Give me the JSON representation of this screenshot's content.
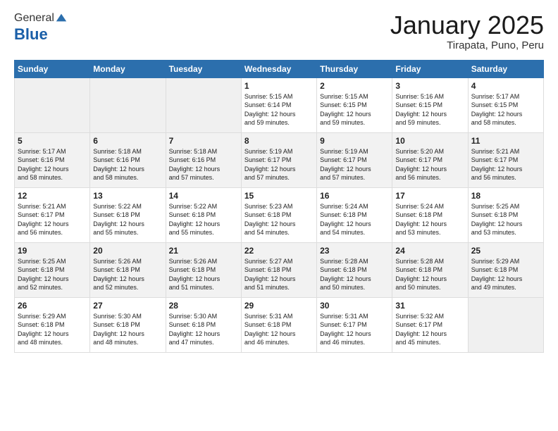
{
  "header": {
    "logo_general": "General",
    "logo_blue": "Blue",
    "calendar_title": "January 2025",
    "calendar_subtitle": "Tirapata, Puno, Peru"
  },
  "days_of_week": [
    "Sunday",
    "Monday",
    "Tuesday",
    "Wednesday",
    "Thursday",
    "Friday",
    "Saturday"
  ],
  "weeks": [
    [
      {
        "num": "",
        "info": ""
      },
      {
        "num": "",
        "info": ""
      },
      {
        "num": "",
        "info": ""
      },
      {
        "num": "1",
        "info": "Sunrise: 5:15 AM\nSunset: 6:14 PM\nDaylight: 12 hours\nand 59 minutes."
      },
      {
        "num": "2",
        "info": "Sunrise: 5:15 AM\nSunset: 6:15 PM\nDaylight: 12 hours\nand 59 minutes."
      },
      {
        "num": "3",
        "info": "Sunrise: 5:16 AM\nSunset: 6:15 PM\nDaylight: 12 hours\nand 59 minutes."
      },
      {
        "num": "4",
        "info": "Sunrise: 5:17 AM\nSunset: 6:15 PM\nDaylight: 12 hours\nand 58 minutes."
      }
    ],
    [
      {
        "num": "5",
        "info": "Sunrise: 5:17 AM\nSunset: 6:16 PM\nDaylight: 12 hours\nand 58 minutes."
      },
      {
        "num": "6",
        "info": "Sunrise: 5:18 AM\nSunset: 6:16 PM\nDaylight: 12 hours\nand 58 minutes."
      },
      {
        "num": "7",
        "info": "Sunrise: 5:18 AM\nSunset: 6:16 PM\nDaylight: 12 hours\nand 57 minutes."
      },
      {
        "num": "8",
        "info": "Sunrise: 5:19 AM\nSunset: 6:17 PM\nDaylight: 12 hours\nand 57 minutes."
      },
      {
        "num": "9",
        "info": "Sunrise: 5:19 AM\nSunset: 6:17 PM\nDaylight: 12 hours\nand 57 minutes."
      },
      {
        "num": "10",
        "info": "Sunrise: 5:20 AM\nSunset: 6:17 PM\nDaylight: 12 hours\nand 56 minutes."
      },
      {
        "num": "11",
        "info": "Sunrise: 5:21 AM\nSunset: 6:17 PM\nDaylight: 12 hours\nand 56 minutes."
      }
    ],
    [
      {
        "num": "12",
        "info": "Sunrise: 5:21 AM\nSunset: 6:17 PM\nDaylight: 12 hours\nand 56 minutes."
      },
      {
        "num": "13",
        "info": "Sunrise: 5:22 AM\nSunset: 6:18 PM\nDaylight: 12 hours\nand 55 minutes."
      },
      {
        "num": "14",
        "info": "Sunrise: 5:22 AM\nSunset: 6:18 PM\nDaylight: 12 hours\nand 55 minutes."
      },
      {
        "num": "15",
        "info": "Sunrise: 5:23 AM\nSunset: 6:18 PM\nDaylight: 12 hours\nand 54 minutes."
      },
      {
        "num": "16",
        "info": "Sunrise: 5:24 AM\nSunset: 6:18 PM\nDaylight: 12 hours\nand 54 minutes."
      },
      {
        "num": "17",
        "info": "Sunrise: 5:24 AM\nSunset: 6:18 PM\nDaylight: 12 hours\nand 53 minutes."
      },
      {
        "num": "18",
        "info": "Sunrise: 5:25 AM\nSunset: 6:18 PM\nDaylight: 12 hours\nand 53 minutes."
      }
    ],
    [
      {
        "num": "19",
        "info": "Sunrise: 5:25 AM\nSunset: 6:18 PM\nDaylight: 12 hours\nand 52 minutes."
      },
      {
        "num": "20",
        "info": "Sunrise: 5:26 AM\nSunset: 6:18 PM\nDaylight: 12 hours\nand 52 minutes."
      },
      {
        "num": "21",
        "info": "Sunrise: 5:26 AM\nSunset: 6:18 PM\nDaylight: 12 hours\nand 51 minutes."
      },
      {
        "num": "22",
        "info": "Sunrise: 5:27 AM\nSunset: 6:18 PM\nDaylight: 12 hours\nand 51 minutes."
      },
      {
        "num": "23",
        "info": "Sunrise: 5:28 AM\nSunset: 6:18 PM\nDaylight: 12 hours\nand 50 minutes."
      },
      {
        "num": "24",
        "info": "Sunrise: 5:28 AM\nSunset: 6:18 PM\nDaylight: 12 hours\nand 50 minutes."
      },
      {
        "num": "25",
        "info": "Sunrise: 5:29 AM\nSunset: 6:18 PM\nDaylight: 12 hours\nand 49 minutes."
      }
    ],
    [
      {
        "num": "26",
        "info": "Sunrise: 5:29 AM\nSunset: 6:18 PM\nDaylight: 12 hours\nand 48 minutes."
      },
      {
        "num": "27",
        "info": "Sunrise: 5:30 AM\nSunset: 6:18 PM\nDaylight: 12 hours\nand 48 minutes."
      },
      {
        "num": "28",
        "info": "Sunrise: 5:30 AM\nSunset: 6:18 PM\nDaylight: 12 hours\nand 47 minutes."
      },
      {
        "num": "29",
        "info": "Sunrise: 5:31 AM\nSunset: 6:18 PM\nDaylight: 12 hours\nand 46 minutes."
      },
      {
        "num": "30",
        "info": "Sunrise: 5:31 AM\nSunset: 6:17 PM\nDaylight: 12 hours\nand 46 minutes."
      },
      {
        "num": "31",
        "info": "Sunrise: 5:32 AM\nSunset: 6:17 PM\nDaylight: 12 hours\nand 45 minutes."
      },
      {
        "num": "",
        "info": ""
      }
    ]
  ]
}
